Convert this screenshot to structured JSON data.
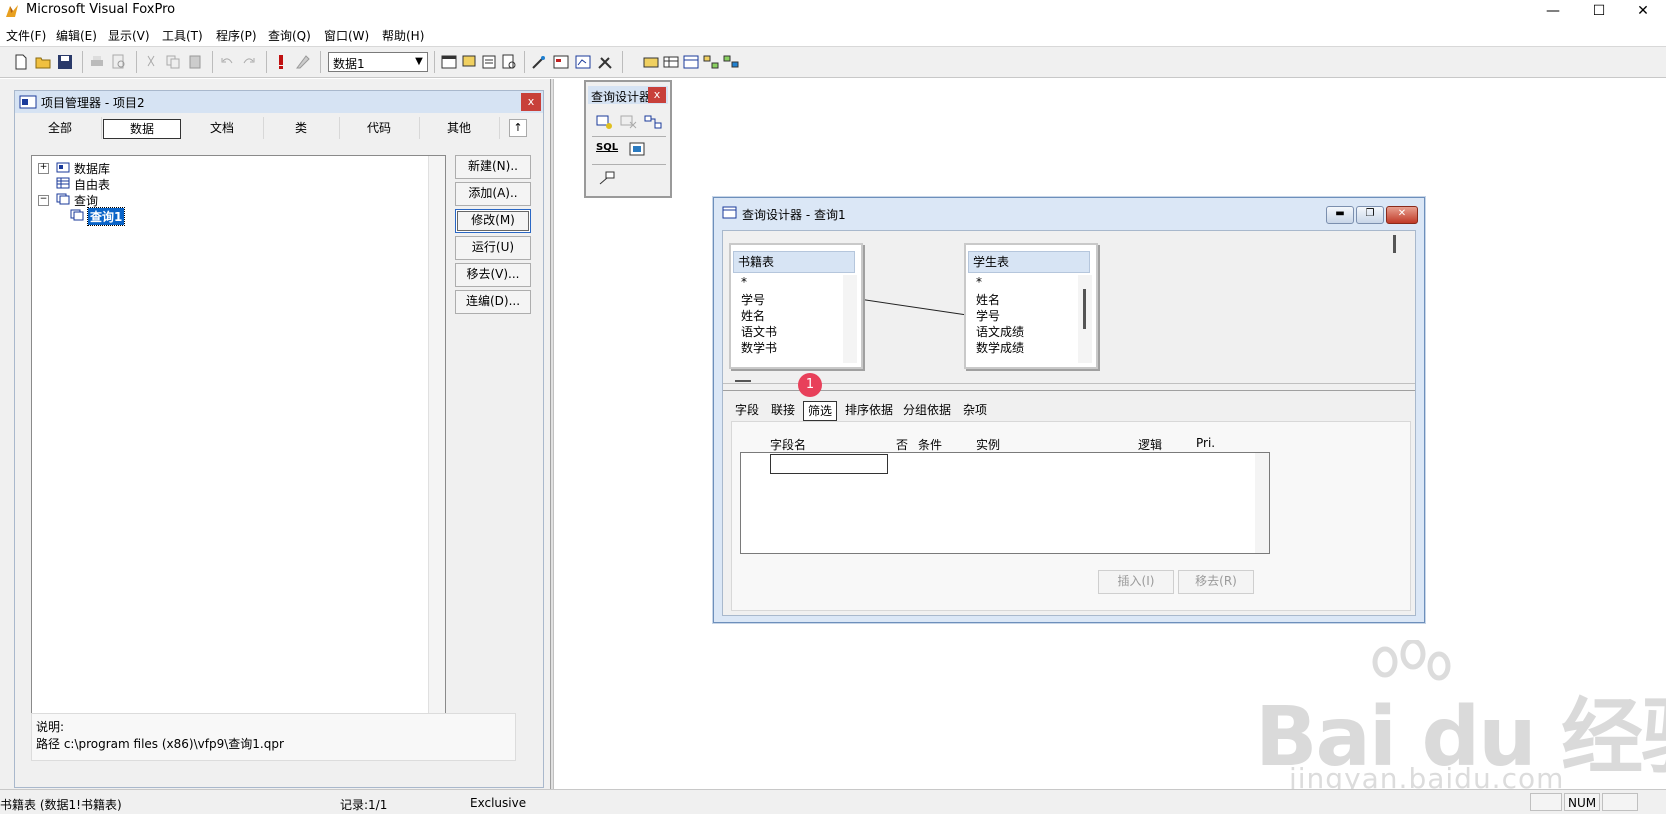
{
  "app": {
    "title": "Microsoft Visual FoxPro"
  },
  "window_buttons": {
    "minimize": "—",
    "maximize": "☐",
    "close": "✕"
  },
  "menu": [
    {
      "label": "文件(F)"
    },
    {
      "label": "编辑(E)"
    },
    {
      "label": "显示(V)"
    },
    {
      "label": "工具(T)"
    },
    {
      "label": "程序(P)"
    },
    {
      "label": "查询(Q)"
    },
    {
      "label": "窗口(W)"
    },
    {
      "label": "帮助(H)"
    }
  ],
  "toolbar": {
    "database_combo": "数据1"
  },
  "project_manager": {
    "title": "项目管理器 - 项目2",
    "close": "x",
    "tabs": [
      {
        "label": "全部"
      },
      {
        "label": "数据"
      },
      {
        "label": "文档"
      },
      {
        "label": "类"
      },
      {
        "label": "代码"
      },
      {
        "label": "其他"
      }
    ],
    "collapse_arrow": "↑",
    "tree": {
      "database": "数据库",
      "free_table": "自由表",
      "query": "查询",
      "query1": "查询1",
      "expand_plus": "+",
      "expand_minus": "−"
    },
    "buttons": {
      "new": "新建(N)..",
      "add": "添加(A)..",
      "modify": "修改(M)",
      "run": "运行(U)",
      "remove": "移去(V)...",
      "build": "连编(D)..."
    },
    "description_label": "说明:",
    "path": "路径 c:\\program files (x86)\\vfp9\\查询1.qpr"
  },
  "query_toolbar": {
    "title": "查询设计器",
    "close": "x",
    "sql_label": "SQL"
  },
  "query_designer": {
    "title": "查询设计器 - 查询1",
    "tables": [
      {
        "name": "书籍表",
        "fields": [
          "*",
          "学号",
          "姓名",
          "语文书",
          "数学书"
        ]
      },
      {
        "name": "学生表",
        "fields": [
          "*",
          "姓名",
          "学号",
          "语文成绩",
          "数学成绩"
        ]
      }
    ],
    "tabs": [
      {
        "label": "字段"
      },
      {
        "label": "联接"
      },
      {
        "label": "筛选"
      },
      {
        "label": "排序依据"
      },
      {
        "label": "分组依据"
      },
      {
        "label": "杂项"
      }
    ],
    "columns": {
      "field_name": "字段名",
      "not": "否",
      "condition": "条件",
      "example": "实例",
      "logic": "逻辑",
      "pri": "Pri."
    },
    "buttons": {
      "insert": "插入(I)",
      "remove": "移去(R)"
    }
  },
  "badge": {
    "number": "1"
  },
  "statusbar": {
    "table": "书籍表 (数据1!书籍表)",
    "record": "记录:1/1",
    "mode": "Exclusive",
    "num": "NUM"
  },
  "watermark": {
    "brand": "Bai du 经验",
    "url": "jingyan.baidu.com"
  },
  "colors": {
    "accent": "#0a64c8",
    "close_red": "#c8403a",
    "badge": "#e8405a"
  }
}
